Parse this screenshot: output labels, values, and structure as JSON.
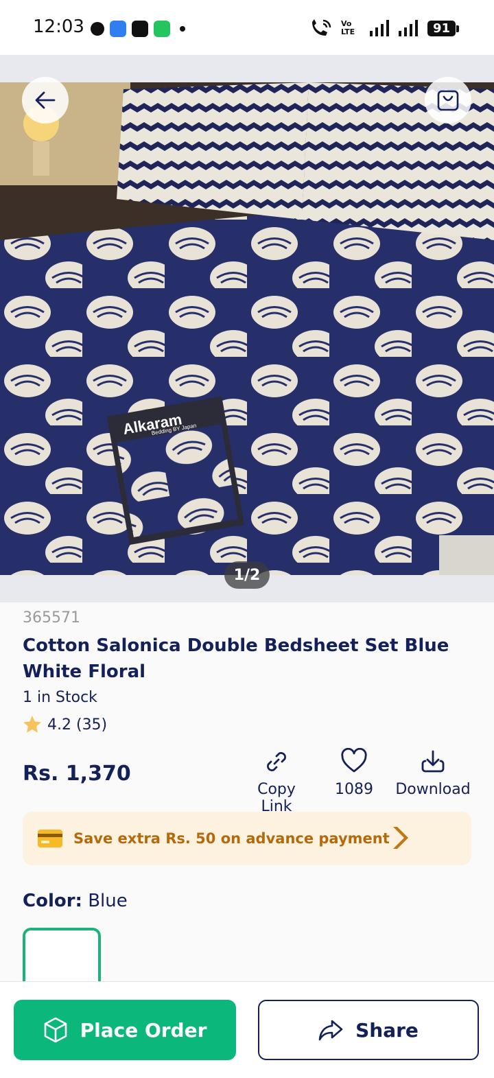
{
  "status_bar": {
    "time": "12:03",
    "battery": "91",
    "network_label": "Vo LTE"
  },
  "gallery": {
    "pager": "1/2",
    "package_brand": "Alkaram",
    "package_tagline": "Bedding BY Japan"
  },
  "product": {
    "sku": "365571",
    "title": "Cotton Salonica Double Bedsheet Set Blue White Floral",
    "stock": "1 in Stock",
    "rating": "4.2 (35)",
    "price": "Rs. 1,370"
  },
  "actions": {
    "copy_link": "Copy Link",
    "likes": "1089",
    "download": "Download"
  },
  "promo": {
    "text": "Save extra Rs. 50 on advance payment"
  },
  "color": {
    "label": "Color:",
    "value": "Blue"
  },
  "bottom": {
    "place_order": "Place Order",
    "share": "Share"
  },
  "colors": {
    "primary_text": "#13205a",
    "accent_green": "#0cb77b",
    "promo_bg": "#fdf1e0",
    "promo_text": "#b36a0c",
    "sheet_blue": "#26306b"
  }
}
